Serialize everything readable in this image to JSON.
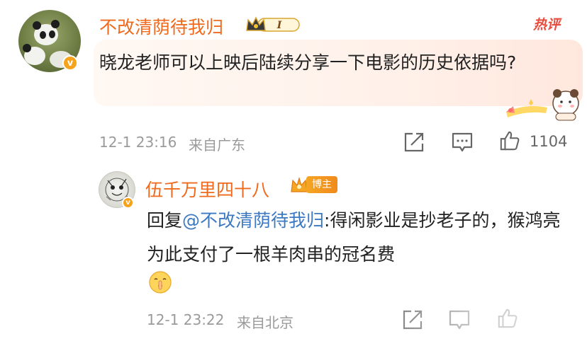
{
  "comment": {
    "username": "不改清荫待我归",
    "level_badge": "I",
    "hot_tag": "热评",
    "text": "晓龙老师可以上映后陆续分享一下电影的历史依据吗?",
    "timestamp": "12-1 23:16",
    "location": "来自广东",
    "like_count": "1104"
  },
  "reply": {
    "username": "伍千万里四十八",
    "author_badge": "博主",
    "prefix": "回复",
    "mention": "@不改清荫待我归",
    "text": ":得闲影业是抄老子的，猴鸿亮为此支付了一根羊肉串的冠名费",
    "emoji": "shush-emoji",
    "timestamp": "12-1 23:22",
    "location": "来自北京"
  },
  "colors": {
    "username": "#ef6a1c",
    "mention": "#3c79c3",
    "hot_tag": "#ea4c3d",
    "meta": "#9a9a9a",
    "verified_badge": "#f7a21b"
  },
  "icons": {
    "share": "share-icon",
    "comment": "comment-icon",
    "like": "like-icon",
    "verified": "verified-badge-icon",
    "crown": "crown-icon"
  }
}
